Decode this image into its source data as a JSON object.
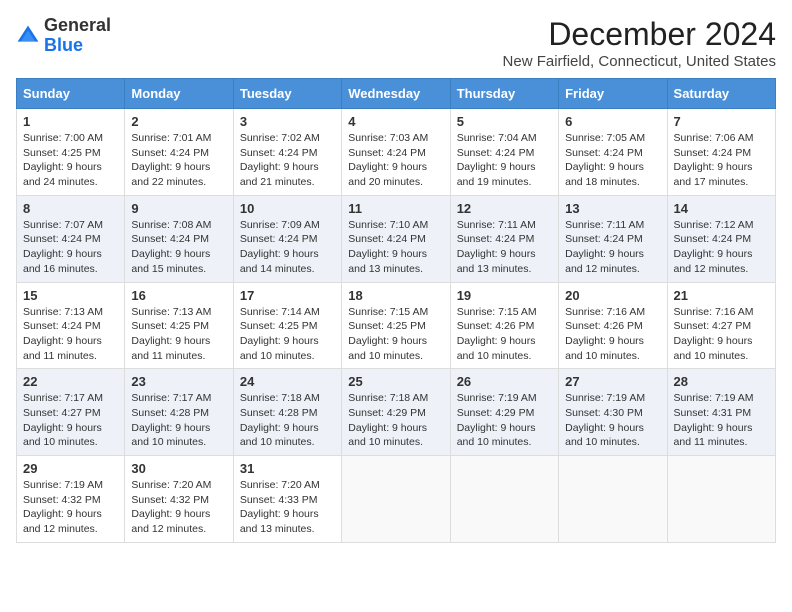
{
  "logo": {
    "general": "General",
    "blue": "Blue"
  },
  "title": "December 2024",
  "location": "New Fairfield, Connecticut, United States",
  "headers": [
    "Sunday",
    "Monday",
    "Tuesday",
    "Wednesday",
    "Thursday",
    "Friday",
    "Saturday"
  ],
  "weeks": [
    [
      {
        "day": "1",
        "sunrise": "7:00 AM",
        "sunset": "4:25 PM",
        "daylight": "9 hours and 24 minutes."
      },
      {
        "day": "2",
        "sunrise": "7:01 AM",
        "sunset": "4:24 PM",
        "daylight": "9 hours and 22 minutes."
      },
      {
        "day": "3",
        "sunrise": "7:02 AM",
        "sunset": "4:24 PM",
        "daylight": "9 hours and 21 minutes."
      },
      {
        "day": "4",
        "sunrise": "7:03 AM",
        "sunset": "4:24 PM",
        "daylight": "9 hours and 20 minutes."
      },
      {
        "day": "5",
        "sunrise": "7:04 AM",
        "sunset": "4:24 PM",
        "daylight": "9 hours and 19 minutes."
      },
      {
        "day": "6",
        "sunrise": "7:05 AM",
        "sunset": "4:24 PM",
        "daylight": "9 hours and 18 minutes."
      },
      {
        "day": "7",
        "sunrise": "7:06 AM",
        "sunset": "4:24 PM",
        "daylight": "9 hours and 17 minutes."
      }
    ],
    [
      {
        "day": "8",
        "sunrise": "7:07 AM",
        "sunset": "4:24 PM",
        "daylight": "9 hours and 16 minutes."
      },
      {
        "day": "9",
        "sunrise": "7:08 AM",
        "sunset": "4:24 PM",
        "daylight": "9 hours and 15 minutes."
      },
      {
        "day": "10",
        "sunrise": "7:09 AM",
        "sunset": "4:24 PM",
        "daylight": "9 hours and 14 minutes."
      },
      {
        "day": "11",
        "sunrise": "7:10 AM",
        "sunset": "4:24 PM",
        "daylight": "9 hours and 13 minutes."
      },
      {
        "day": "12",
        "sunrise": "7:11 AM",
        "sunset": "4:24 PM",
        "daylight": "9 hours and 13 minutes."
      },
      {
        "day": "13",
        "sunrise": "7:11 AM",
        "sunset": "4:24 PM",
        "daylight": "9 hours and 12 minutes."
      },
      {
        "day": "14",
        "sunrise": "7:12 AM",
        "sunset": "4:24 PM",
        "daylight": "9 hours and 12 minutes."
      }
    ],
    [
      {
        "day": "15",
        "sunrise": "7:13 AM",
        "sunset": "4:24 PM",
        "daylight": "9 hours and 11 minutes."
      },
      {
        "day": "16",
        "sunrise": "7:13 AM",
        "sunset": "4:25 PM",
        "daylight": "9 hours and 11 minutes."
      },
      {
        "day": "17",
        "sunrise": "7:14 AM",
        "sunset": "4:25 PM",
        "daylight": "9 hours and 10 minutes."
      },
      {
        "day": "18",
        "sunrise": "7:15 AM",
        "sunset": "4:25 PM",
        "daylight": "9 hours and 10 minutes."
      },
      {
        "day": "19",
        "sunrise": "7:15 AM",
        "sunset": "4:26 PM",
        "daylight": "9 hours and 10 minutes."
      },
      {
        "day": "20",
        "sunrise": "7:16 AM",
        "sunset": "4:26 PM",
        "daylight": "9 hours and 10 minutes."
      },
      {
        "day": "21",
        "sunrise": "7:16 AM",
        "sunset": "4:27 PM",
        "daylight": "9 hours and 10 minutes."
      }
    ],
    [
      {
        "day": "22",
        "sunrise": "7:17 AM",
        "sunset": "4:27 PM",
        "daylight": "9 hours and 10 minutes."
      },
      {
        "day": "23",
        "sunrise": "7:17 AM",
        "sunset": "4:28 PM",
        "daylight": "9 hours and 10 minutes."
      },
      {
        "day": "24",
        "sunrise": "7:18 AM",
        "sunset": "4:28 PM",
        "daylight": "9 hours and 10 minutes."
      },
      {
        "day": "25",
        "sunrise": "7:18 AM",
        "sunset": "4:29 PM",
        "daylight": "9 hours and 10 minutes."
      },
      {
        "day": "26",
        "sunrise": "7:19 AM",
        "sunset": "4:29 PM",
        "daylight": "9 hours and 10 minutes."
      },
      {
        "day": "27",
        "sunrise": "7:19 AM",
        "sunset": "4:30 PM",
        "daylight": "9 hours and 10 minutes."
      },
      {
        "day": "28",
        "sunrise": "7:19 AM",
        "sunset": "4:31 PM",
        "daylight": "9 hours and 11 minutes."
      }
    ],
    [
      {
        "day": "29",
        "sunrise": "7:19 AM",
        "sunset": "4:32 PM",
        "daylight": "9 hours and 12 minutes."
      },
      {
        "day": "30",
        "sunrise": "7:20 AM",
        "sunset": "4:32 PM",
        "daylight": "9 hours and 12 minutes."
      },
      {
        "day": "31",
        "sunrise": "7:20 AM",
        "sunset": "4:33 PM",
        "daylight": "9 hours and 13 minutes."
      },
      null,
      null,
      null,
      null
    ]
  ],
  "labels": {
    "sunrise": "Sunrise:",
    "sunset": "Sunset:",
    "daylight": "Daylight:"
  }
}
